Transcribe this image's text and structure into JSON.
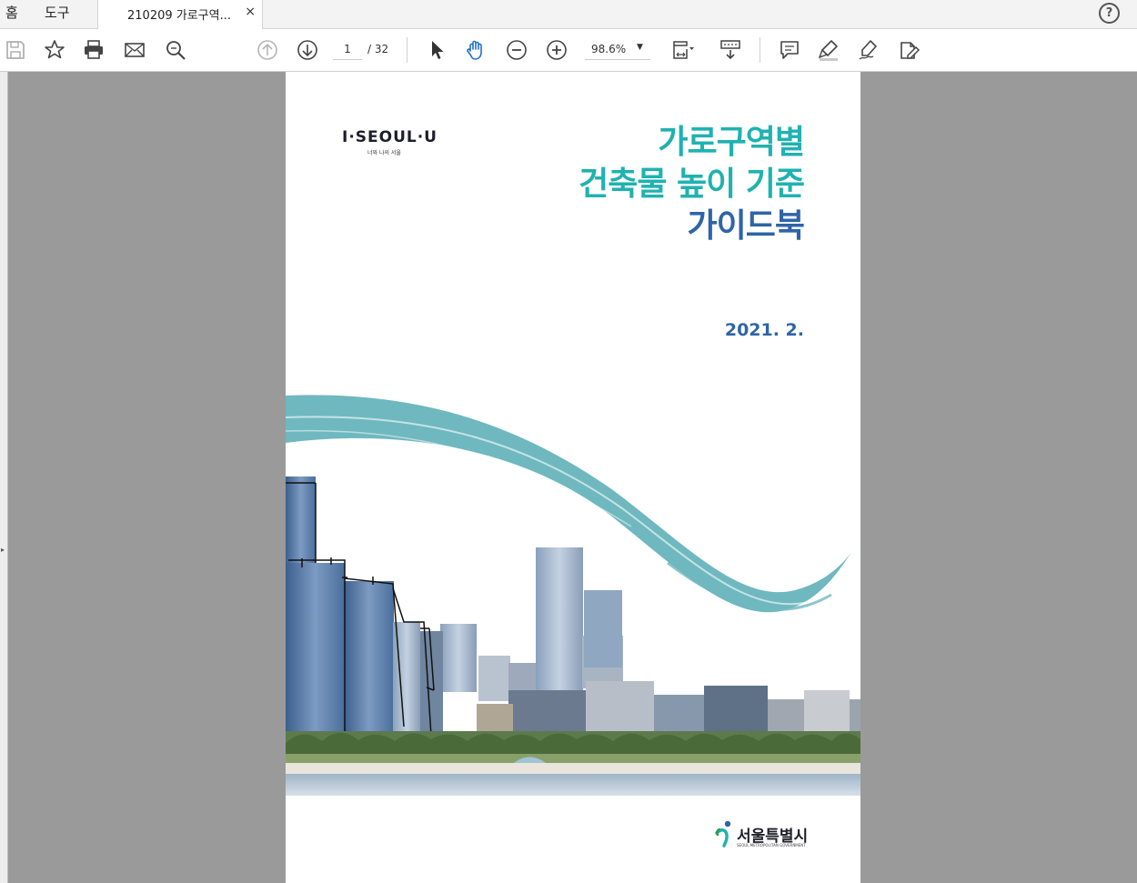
{
  "tabbar": {
    "home_label": "홈",
    "tools_label": "도구",
    "doc_tab_label": "210209 가로구역...",
    "close_glyph": "×",
    "help_glyph": "?"
  },
  "toolbar": {
    "page_current": "1",
    "page_total": "/ 32",
    "zoom_value": "98.6%",
    "zoom_caret": "▼",
    "icons": [
      "save-icon",
      "bookmark-star-icon",
      "print-icon",
      "email-icon",
      "search-icon",
      "prev-page-icon",
      "next-page-icon",
      "select-cursor-icon",
      "hand-icon",
      "zoom-out-icon",
      "zoom-in-icon",
      "fit-page-icon",
      "scroll-mode-icon",
      "comment-icon",
      "highlight-icon",
      "sign-icon",
      "fill-sign-icon"
    ]
  },
  "document": {
    "logo": "I·SEOUL·U",
    "logo_sub": "너와 나의 서울",
    "title_line1": "가로구역별",
    "title_line2": "건축물 높이 기준",
    "title_line3": "가이드북",
    "date": "2021. 2.",
    "publisher": "서울특별시",
    "publisher_sub": "SEOUL METROPOLITAN GOVERNMENT",
    "colors": {
      "teal": "#1fb2b0",
      "blue": "#2f64a8",
      "brush": "#6fb8bf"
    }
  }
}
